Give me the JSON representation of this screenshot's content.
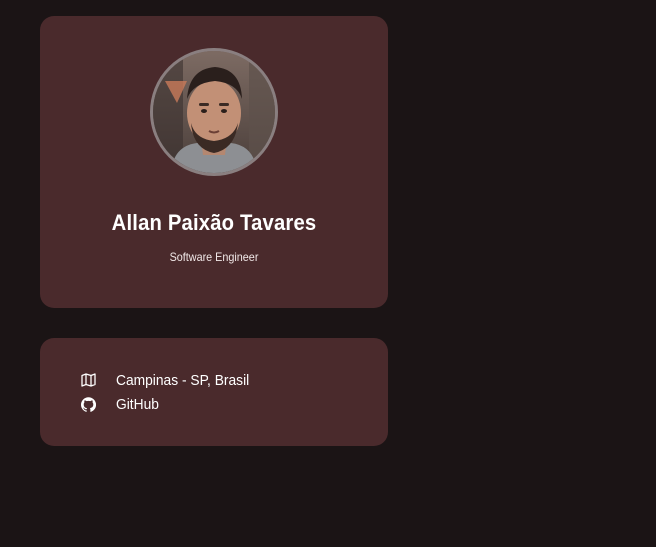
{
  "profile": {
    "name": "Allan Paixão Tavares",
    "role": "Software Engineer",
    "avatar_icon": "profile-photo"
  },
  "info": {
    "location": {
      "icon": "map-icon",
      "text": "Campinas - SP, Brasil"
    },
    "github": {
      "icon": "github-icon",
      "text": "GitHub"
    }
  },
  "colors": {
    "background": "#1b1415",
    "card": "#4a2a2c",
    "text": "#ffffff",
    "avatar_border": "#8a7f80"
  }
}
